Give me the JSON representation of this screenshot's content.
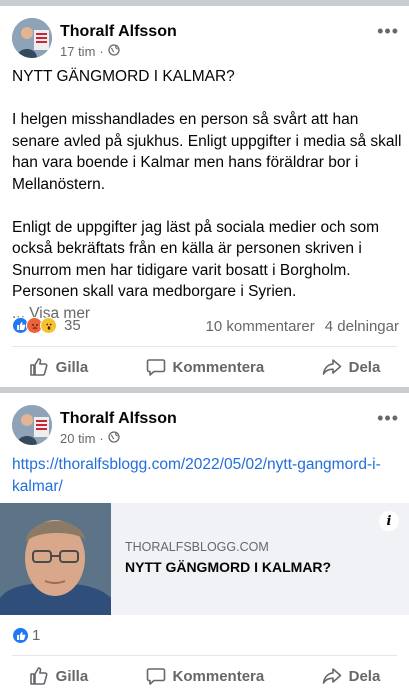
{
  "posts": [
    {
      "author": "Thoralf Alfsson",
      "time": "17 tim",
      "more_label": "•••",
      "paragraphs": [
        "NYTT GÄNGMORD I KALMAR?",
        "I helgen misshandlades en person så svårt att han senare avled på sjukhus. Enligt uppgifter i media så skall han vara boende i Kalmar men hans föräldrar bor i Mellanöstern.",
        "Enligt de uppgifter jag läst på sociala medier och som också bekräftats från en källa är personen skriven i Snurrom men har tidigare varit bosatt i Borgholm. Personen skall vara medborgare i Syrien."
      ],
      "see_more": "... Visa mer",
      "reaction_count": "35",
      "comments": "10 kommentarer",
      "shares": "4 delningar",
      "actions": {
        "like": "Gilla",
        "comment": "Kommentera",
        "share": "Dela"
      }
    },
    {
      "author": "Thoralf Alfsson",
      "time": "20 tim",
      "more_label": "•••",
      "link": "https://thoralfsblogg.com/2022/05/02/nytt-gangmord-i-kalmar/",
      "preview": {
        "domain": "THORALFSBLOGG.COM",
        "title": "NYTT GÄNGMORD I KALMAR?",
        "info": "i"
      },
      "reaction_count": "1",
      "actions": {
        "like": "Gilla",
        "comment": "Kommentera",
        "share": "Dela"
      }
    }
  ],
  "colors": {
    "like_blue": "#2078f4",
    "angry_orange": "#f0603a",
    "wow_yellow": "#f7c02c",
    "link_blue": "#216fdb",
    "muted": "#65676b"
  },
  "icons": [
    "globe-icon",
    "more-icon",
    "like-icon",
    "comment-icon",
    "share-icon",
    "info-icon"
  ]
}
